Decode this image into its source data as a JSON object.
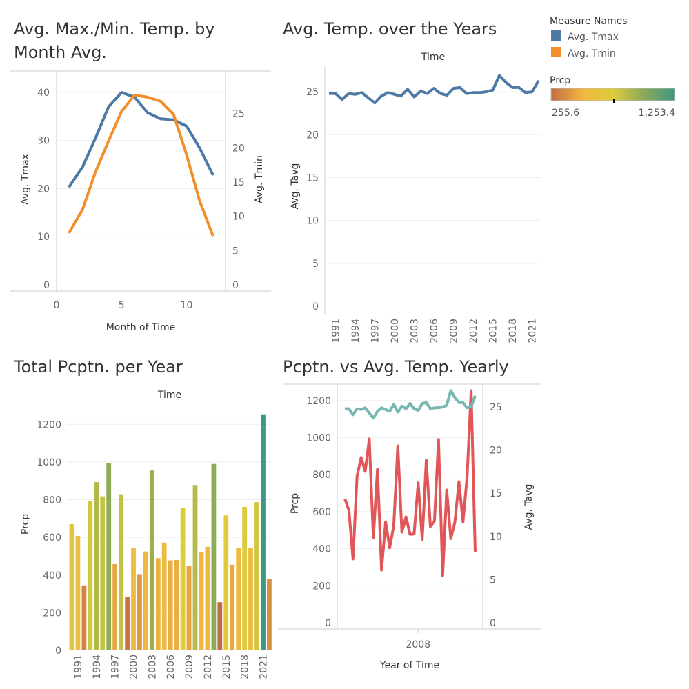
{
  "colors": {
    "tmax": "#4e79a7",
    "tmin": "#f28e2b",
    "tavg": "#4e79a7",
    "tavg_teal": "#76b7b2",
    "prcp_line": "#e15759",
    "prcp_gradient": [
      "#c36b46",
      "#f1b640",
      "#dccd3c",
      "#8ca956",
      "#3f9883"
    ]
  },
  "legend": {
    "measure_title": "Measure Names",
    "measure_items": [
      {
        "label": "Avg. Tmax",
        "color": "#4e79a7"
      },
      {
        "label": "Avg. Tmin",
        "color": "#f28e2b"
      }
    ],
    "prcp_title": "Prcp",
    "prcp_min": "255.6",
    "prcp_max": "1,253.4"
  },
  "chart_data": [
    {
      "type": "line",
      "title_lines": [
        "Avg. Max./Min. Temp. by",
        "Month Avg."
      ],
      "xlabel": "Month of Time",
      "ylabel": "Avg. Tmax",
      "y2label": "Avg. Tmin",
      "xlim": [
        0,
        13
      ],
      "xticks": [
        0,
        5,
        10
      ],
      "ylim": [
        0,
        42
      ],
      "yticks": [
        0,
        10,
        20,
        30,
        40
      ],
      "y2lim": [
        0,
        29.5
      ],
      "y2ticks": [
        0,
        5,
        10,
        15,
        20,
        25
      ],
      "x": [
        1,
        2,
        3,
        4,
        5,
        6,
        7,
        8,
        9,
        10,
        11,
        12
      ],
      "series": [
        {
          "name": "Avg. Tmax",
          "axis": "left",
          "values": [
            20.5,
            24.5,
            30.5,
            37.0,
            40.0,
            39.0,
            35.8,
            34.5,
            34.3,
            33.0,
            28.5,
            23.0
          ]
        },
        {
          "name": "Avg. Tmin",
          "axis": "right",
          "values": [
            7.7,
            11.0,
            16.5,
            21.0,
            25.3,
            27.7,
            27.4,
            26.8,
            24.9,
            19.0,
            12.3,
            7.3
          ]
        }
      ]
    },
    {
      "type": "line",
      "title": "Avg. Temp. over the Years",
      "header": "Time",
      "ylabel": "Avg. Tavg",
      "ylim": [
        0,
        27.5
      ],
      "yticks": [
        0,
        5,
        10,
        15,
        20,
        25
      ],
      "xtick_labels": [
        "1991",
        "1994",
        "1997",
        "2000",
        "2003",
        "2006",
        "2009",
        "2012",
        "2015",
        "2018",
        "2021"
      ],
      "x": [
        1990,
        1991,
        1992,
        1993,
        1994,
        1995,
        1996,
        1997,
        1998,
        1999,
        2000,
        2001,
        2002,
        2003,
        2004,
        2005,
        2006,
        2007,
        2008,
        2009,
        2010,
        2011,
        2012,
        2013,
        2014,
        2015,
        2016,
        2017,
        2018,
        2019,
        2020,
        2021,
        2022
      ],
      "series": [
        {
          "name": "Avg. Tavg",
          "values": [
            24.8,
            24.8,
            24.1,
            24.8,
            24.7,
            24.9,
            24.3,
            23.7,
            24.5,
            24.9,
            24.7,
            24.5,
            25.3,
            24.4,
            25.1,
            24.8,
            25.4,
            24.8,
            24.6,
            25.4,
            25.5,
            24.8,
            24.9,
            24.9,
            25.0,
            25.2,
            26.9,
            26.1,
            25.5,
            25.5,
            24.9,
            25.0,
            26.3
          ]
        }
      ]
    },
    {
      "type": "bar",
      "title": "Total Pcptn. per Year",
      "header": "Time",
      "ylabel": "Prcp",
      "ylim": [
        0,
        1300
      ],
      "yticks": [
        0,
        200,
        400,
        600,
        800,
        1000,
        1200
      ],
      "xtick_labels": [
        "1991",
        "1994",
        "1997",
        "2000",
        "2003",
        "2006",
        "2009",
        "2012",
        "2015",
        "2018",
        "2021"
      ],
      "color_scale": {
        "field": "Prcp",
        "min": 255.6,
        "max": 1253.4
      },
      "categories": [
        "1990",
        "1991",
        "1992",
        "1993",
        "1994",
        "1995",
        "1996",
        "1997",
        "1998",
        "1999",
        "2000",
        "2001",
        "2002",
        "2003",
        "2004",
        "2005",
        "2006",
        "2007",
        "2008",
        "2009",
        "2010",
        "2011",
        "2012",
        "2013",
        "2014",
        "2015",
        "2016",
        "2017",
        "2018",
        "2019",
        "2020",
        "2021",
        "2022"
      ],
      "values": [
        670,
        608,
        345,
        792,
        893,
        818,
        993,
        458,
        829,
        285,
        545,
        405,
        525,
        955,
        490,
        572,
        478,
        480,
        755,
        450,
        878,
        520,
        550,
        990,
        255.6,
        717,
        455,
        543,
        762,
        545,
        787,
        1253.4,
        380
      ]
    },
    {
      "type": "line",
      "title": "Pcptn. vs Avg. Temp. Yearly",
      "xlabel": "Year of Time",
      "ylabel": "Prcp",
      "y2label": "Avg. Tavg",
      "xtick_label": "2008",
      "ylim": [
        0,
        1300
      ],
      "yticks": [
        0,
        200,
        400,
        600,
        800,
        1000,
        1200
      ],
      "y2lim": [
        0,
        28.2
      ],
      "y2ticks": [
        0,
        5,
        10,
        15,
        20,
        25
      ],
      "x": [
        1990,
        1991,
        1992,
        1993,
        1994,
        1995,
        1996,
        1997,
        1998,
        1999,
        2000,
        2001,
        2002,
        2003,
        2004,
        2005,
        2006,
        2007,
        2008,
        2009,
        2010,
        2011,
        2012,
        2013,
        2014,
        2015,
        2016,
        2017,
        2018,
        2019,
        2020,
        2021,
        2022
      ],
      "series": [
        {
          "name": "Prcp",
          "axis": "left",
          "values": [
            670,
            608,
            345,
            792,
            893,
            818,
            993,
            458,
            829,
            285,
            545,
            405,
            525,
            955,
            490,
            572,
            478,
            480,
            755,
            450,
            878,
            520,
            550,
            990,
            255.6,
            717,
            455,
            543,
            762,
            545,
            787,
            1253.4,
            380
          ]
        },
        {
          "name": "Avg. Tavg",
          "axis": "right",
          "values": [
            24.8,
            24.8,
            24.1,
            24.8,
            24.7,
            24.9,
            24.3,
            23.7,
            24.5,
            24.9,
            24.7,
            24.5,
            25.3,
            24.4,
            25.1,
            24.8,
            25.4,
            24.8,
            24.6,
            25.4,
            25.5,
            24.8,
            24.9,
            24.9,
            25.0,
            25.2,
            26.9,
            26.1,
            25.5,
            25.5,
            24.9,
            25.0,
            26.3
          ]
        }
      ]
    }
  ]
}
